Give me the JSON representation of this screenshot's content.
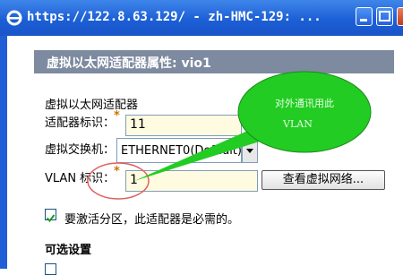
{
  "window": {
    "title": "https://122.8.63.129/ - zh-HMC-129: ..."
  },
  "header": {
    "title": "虚拟以太网适配器属性: vio1"
  },
  "form": {
    "adapter_label": "虚拟以太网适配器",
    "adapter_id_label": "适配器标识：",
    "adapter_id_value": "11",
    "vswitch_label": "虚拟交换机：",
    "vswitch_value": "ETHERNET0(Default)",
    "vlan_label": "VLAN 标识：",
    "vlan_value": "1",
    "view_networks_button": "查看虚拟网络...",
    "required_marker": "*",
    "required_checkbox_label": "要激活分区，此适配器是必需的。",
    "required_checked": true,
    "optional_section": "可选设置"
  },
  "annotation": {
    "bubble_line1": "对外通讯用此",
    "bubble_line2": "VLAN"
  },
  "colors": {
    "titlebar": "#1c5fd6",
    "header": "#7d8aa0",
    "bubble": "#22cc22",
    "circle": "#e06060",
    "field_bg": "#fffbe0"
  }
}
